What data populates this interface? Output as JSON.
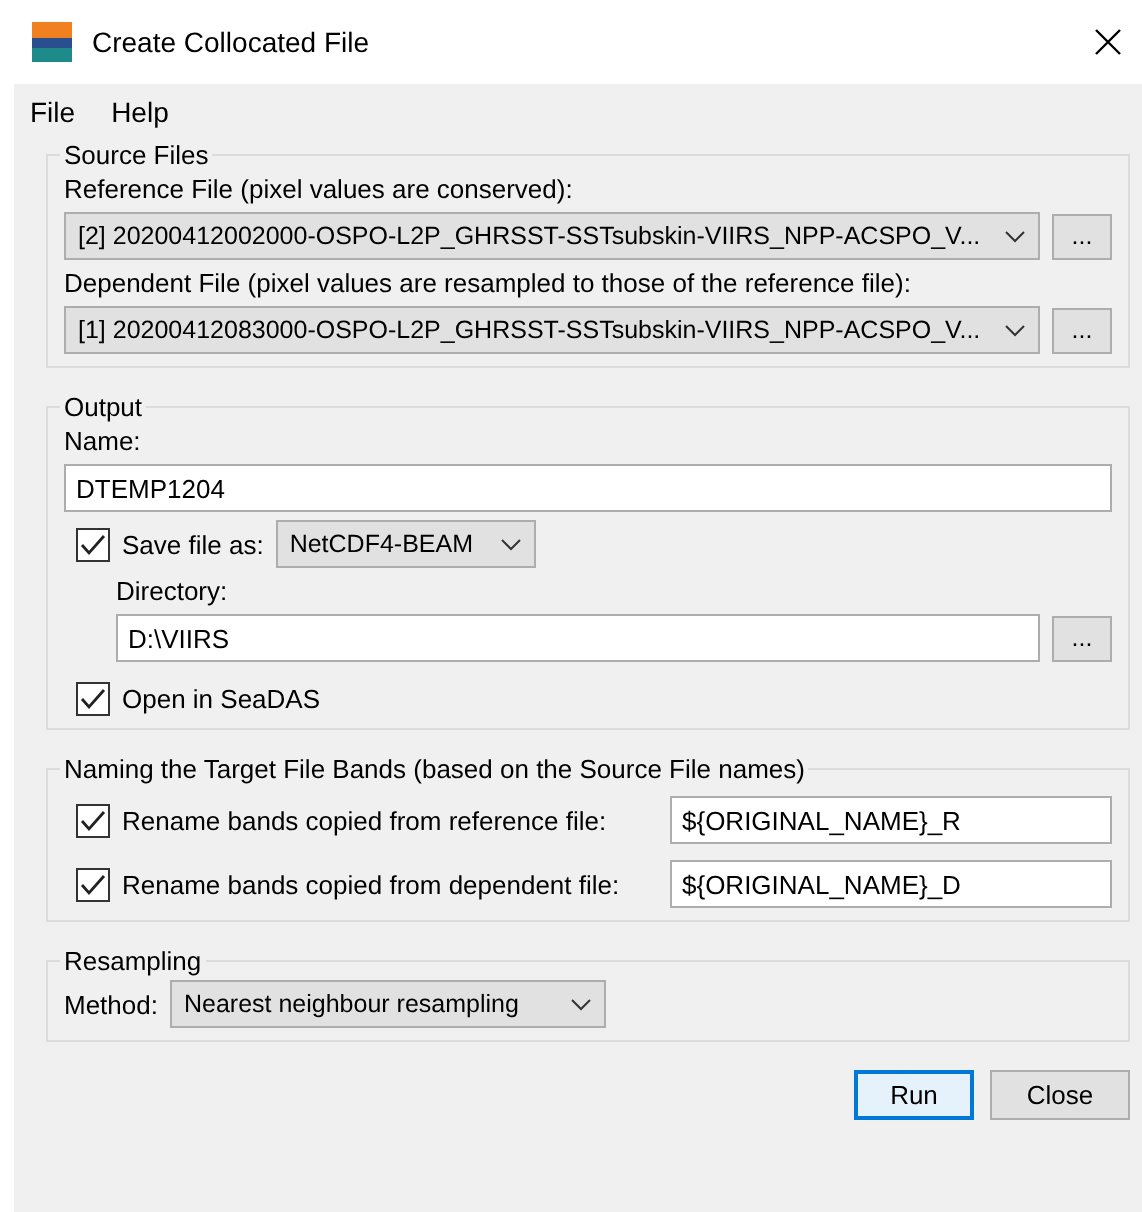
{
  "window": {
    "title": "Create Collocated File"
  },
  "menu": [
    "File",
    "Help"
  ],
  "source_files": {
    "title": "Source Files",
    "files": [
      {
        "label": "Reference File (pixel values are conserved):",
        "value": "[2] 20200412002000-OSPO-L2P_GHRSST-SSTsubskin-VIIRS_NPP-ACSPO_V...",
        "browse": "..."
      },
      {
        "label": "Dependent File (pixel values are resampled to those of the reference file):",
        "value": "[1] 20200412083000-OSPO-L2P_GHRSST-SSTsubskin-VIIRS_NPP-ACSPO_V...",
        "browse": "..."
      }
    ]
  },
  "output": {
    "title": "Output",
    "name_label": "Name:",
    "name_value": "DTEMP1204",
    "save": {
      "label": "Save file as:",
      "checked": true,
      "format": "NetCDF4-BEAM"
    },
    "directory_label": "Directory:",
    "directory_value": "D:\\VIIRS",
    "browse": "...",
    "open": {
      "label": "Open in SeaDAS",
      "checked": true
    }
  },
  "naming": {
    "title": "Naming the Target File Bands (based on the Source File names)",
    "rows": [
      {
        "label": "Rename bands copied from reference file:",
        "checked": true,
        "value": "${ORIGINAL_NAME}_R"
      },
      {
        "label": "Rename bands copied from dependent file:",
        "checked": true,
        "value": "${ORIGINAL_NAME}_D"
      }
    ]
  },
  "resampling": {
    "title": "Resampling",
    "method_label": "Method:",
    "method": "Nearest neighbour resampling"
  },
  "buttons": [
    {
      "label": "Run",
      "default": true
    },
    {
      "label": "Close",
      "default": false
    }
  ]
}
